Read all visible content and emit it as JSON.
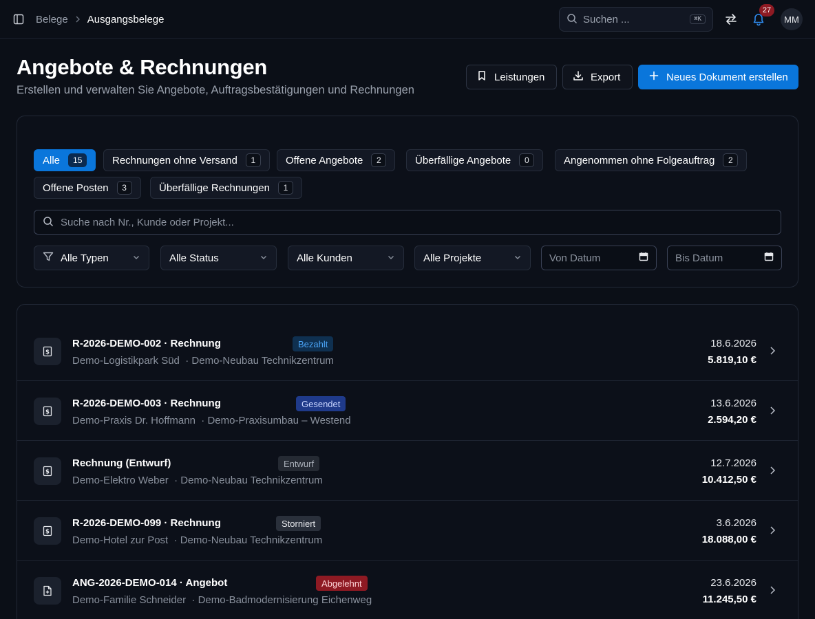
{
  "breadcrumb": {
    "parent": "Belege",
    "current": "Ausgangsbelege"
  },
  "topbar": {
    "search_placeholder": "Suchen ...",
    "shortcut": "⌘K",
    "notifications": "27",
    "avatar": "MM"
  },
  "header": {
    "title": "Angebote & Rechnungen",
    "subtitle": "Erstellen und verwalten Sie Angebote, Auftragsbestätigungen und Rechnungen",
    "btn_leistungen": "Leistungen",
    "btn_export": "Export",
    "btn_new": "Neues Dokument erstellen"
  },
  "filters": {
    "chips": [
      {
        "label": "Alle",
        "count": "15",
        "active": true
      },
      {
        "label": "Rechnungen ohne Versand",
        "count": "1"
      },
      {
        "label": "Offene Angebote",
        "count": "2"
      },
      {
        "label": "Überfällige Angebote",
        "count": "0"
      },
      {
        "label": "Angenommen ohne Folgeauftrag",
        "count": "2"
      },
      {
        "label": "Offene Posten",
        "count": "3"
      },
      {
        "label": "Überfällige Rechnungen",
        "count": "1"
      }
    ],
    "search_placeholder": "Suche nach Nr., Kunde oder Projekt...",
    "selects": [
      "Alle Typen",
      "Alle Status",
      "Alle Kunden",
      "Alle Projekte"
    ],
    "date_from": "Von Datum",
    "date_to": "Bis Datum"
  },
  "colors": {
    "accent": "#0a76db",
    "status_bezahlt": "#0f3050",
    "status_gesendet": "#1f3a8a",
    "status_entwurf": "#252a33",
    "status_storniert": "#2a303b",
    "status_abgelehnt": "#8e1a23"
  },
  "documents": [
    {
      "title": "R-2026-DEMO-002 · Rechnung",
      "status": "Bezahlt",
      "customer": "Demo-Logistikpark Süd",
      "project": "· Demo-Neubau Technikzentrum",
      "date": "18.6.2026",
      "amount": "5.819,10 €",
      "icon": "invoice-icon"
    },
    {
      "title": "R-2026-DEMO-003 · Rechnung",
      "status": "Gesendet",
      "customer": "Demo-Praxis Dr. Hoffmann",
      "project": "· Demo-Praxisumbau – Westend",
      "date": "13.6.2026",
      "amount": "2.594,20 €",
      "icon": "invoice-icon"
    },
    {
      "title": "Rechnung (Entwurf)",
      "status": "Entwurf",
      "customer": "Demo-Elektro Weber",
      "project": "· Demo-Neubau Technikzentrum",
      "date": "12.7.2026",
      "amount": "10.412,50 €",
      "icon": "invoice-icon"
    },
    {
      "title": "R-2026-DEMO-099 · Rechnung",
      "status": "Storniert",
      "customer": "Demo-Hotel zur Post",
      "project": "· Demo-Neubau Technikzentrum",
      "date": "3.6.2026",
      "amount": "18.088,00 €",
      "icon": "invoice-icon"
    },
    {
      "title": "ANG-2026-DEMO-014 · Angebot",
      "status": "Abgelehnt",
      "customer": "Demo-Familie Schneider",
      "project": "· Demo-Badmodernisierung Eichenweg",
      "date": "23.6.2026",
      "amount": "11.245,50 €",
      "icon": "quote-icon"
    }
  ]
}
